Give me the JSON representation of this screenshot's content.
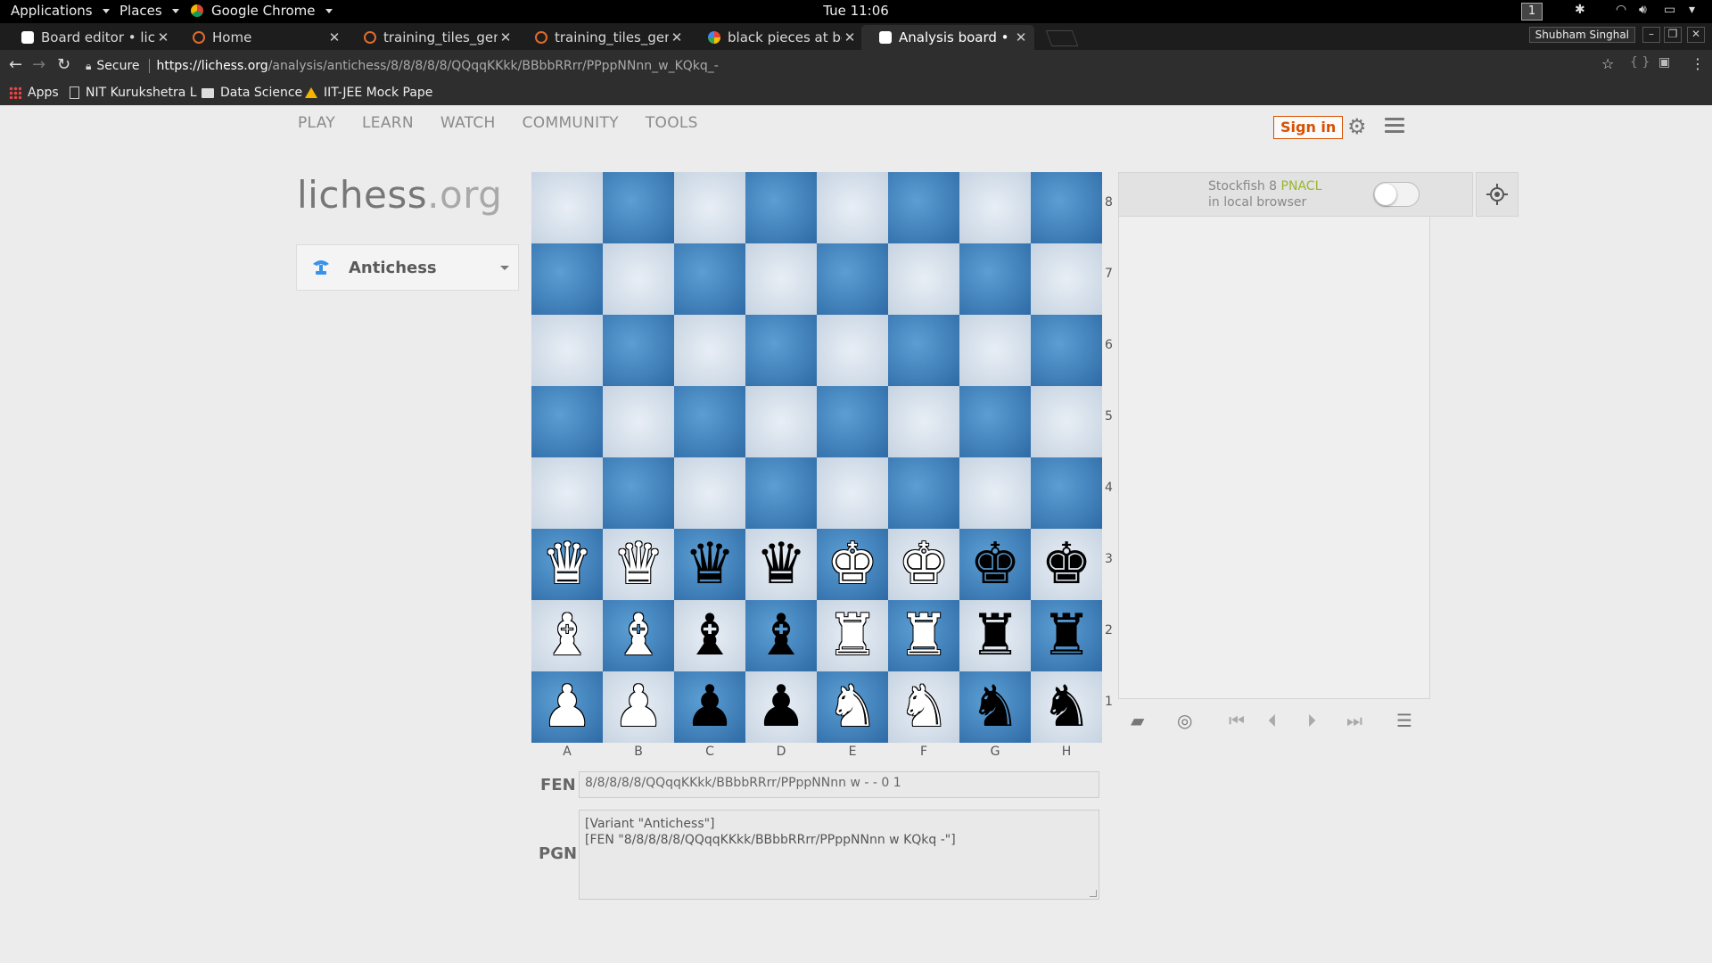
{
  "os": {
    "menus": [
      "Applications",
      "Places",
      "Google Chrome"
    ],
    "clock": "Tue 11:06",
    "workspace": "1"
  },
  "browser": {
    "tabs": [
      {
        "title": "Board editor • liche",
        "icon": "lichess-knight-icon",
        "active": false
      },
      {
        "title": "Home",
        "icon": "loading-ring-icon",
        "active": false
      },
      {
        "title": "training_tiles_gener",
        "icon": "loading-ring-icon",
        "active": false
      },
      {
        "title": "training_tiles_gener",
        "icon": "loading-ring-icon",
        "active": false
      },
      {
        "title": "black pieces at bott",
        "icon": "google-icon",
        "active": false
      },
      {
        "title": "Analysis board • lich",
        "icon": "lichess-knight-icon",
        "active": true
      }
    ],
    "profile": "Shubham Singhal",
    "secure_label": "Secure",
    "url_host": "https://lichess.org",
    "url_path": "/analysis/antichess/8/8/8/8/8/QQqqKKkk/BBbbRRrr/PPppNNnn_w_KQkq_-",
    "bookmarks": [
      "Apps",
      "NIT Kurukshetra L",
      "Data Science",
      "IIT-JEE Mock Pape"
    ]
  },
  "site": {
    "nav": [
      "PLAY",
      "LEARN",
      "WATCH",
      "COMMUNITY",
      "TOOLS"
    ],
    "signin": "Sign in",
    "logo_main": "lichess",
    "logo_tld": ".org",
    "variant": "Antichess"
  },
  "board": {
    "orientation": "white",
    "light_color": "#d6dfea",
    "dark_color": "#3f7fbf",
    "ranks": [
      "........",
      "........",
      "........",
      "........",
      "........",
      "QQqqKKkk",
      "BBbbRRrr",
      "PPppNNnn"
    ],
    "rank_labels": [
      "8",
      "7",
      "6",
      "5",
      "4",
      "3",
      "2",
      "1"
    ],
    "file_labels": [
      "A",
      "B",
      "C",
      "D",
      "E",
      "F",
      "G",
      "H"
    ]
  },
  "fen_label": "FEN",
  "fen": "8/8/8/8/8/QQqqKKkk/BBbbRRrr/PPppNNnn w - - 0 1",
  "pgn_label": "PGN",
  "pgn_lines": [
    "[Variant \"Antichess\"]",
    "[FEN \"8/8/8/8/8/QQqqKKkk/BBbbRRrr/PPppNNnn w KQkq -\"]"
  ],
  "engine": {
    "name": "Stockfish 8",
    "build": "PNACL",
    "subtitle": "in local browser",
    "enabled": false
  }
}
